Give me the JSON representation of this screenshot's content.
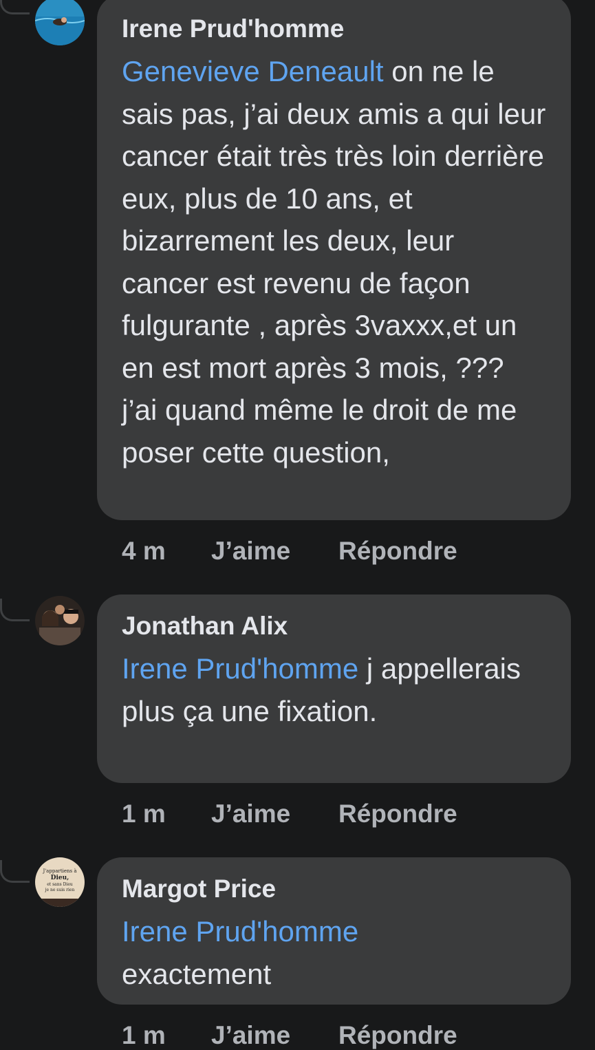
{
  "comments": [
    {
      "author": "Irene Prud'homme",
      "mention": "Genevieve Deneault",
      "text": " on ne le sais pas, j’ai deux amis a qui leur cancer était très très loin derrière eux, plus de 10 ans, et bizarrement les deux, leur cancer est revenu de façon fulgurante , après 3vaxxx,et un en est mort après 3 mois, ???  j’ai quand même le droit de me poser cette question,",
      "time": "4 m",
      "like_label": "J’aime",
      "reply_label": "Répondre",
      "avatar_icon": "swimmer-photo-avatar"
    },
    {
      "author": "Jonathan Alix",
      "mention": "Irene Prud'homme",
      "text": " j appellerais plus ça une fixation.",
      "time": "1 m",
      "like_label": "J’aime",
      "reply_label": "Répondre",
      "avatar_icon": "group-photo-avatar"
    },
    {
      "author": "Margot Price",
      "mention": "Irene Prud'homme",
      "text": " exactement",
      "time": "1 m",
      "like_label": "J’aime",
      "reply_label": "Répondre",
      "avatar_icon": "text-image-avatar",
      "avatar_text": [
        "J'appartiens à",
        "Dieu,",
        "et sans Dieu",
        "je ne suis rien"
      ]
    }
  ],
  "colors": {
    "background": "#18191a",
    "bubble": "#3a3b3c",
    "mention": "#5fa4f0",
    "secondary_text": "#b0b3b8"
  }
}
